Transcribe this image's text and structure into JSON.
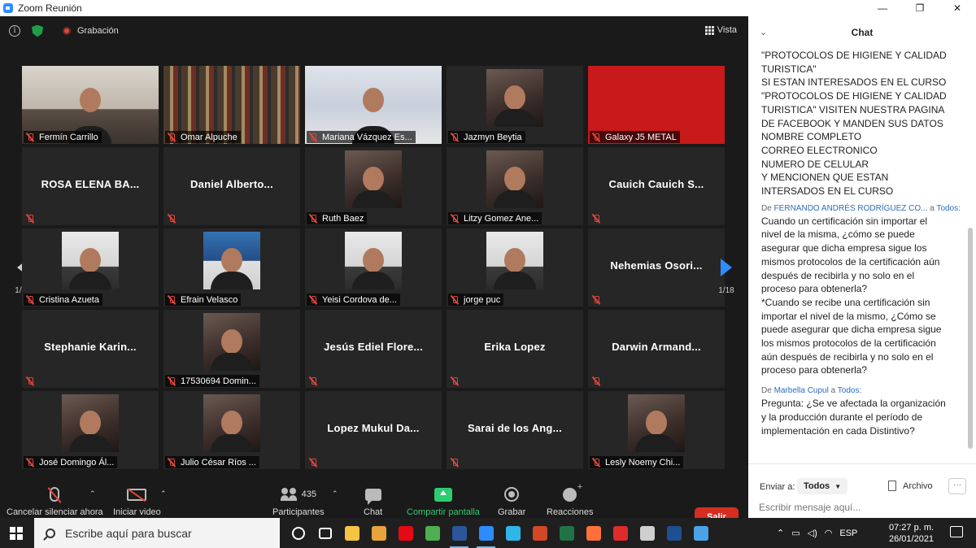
{
  "window": {
    "title": "Zoom Reunión",
    "controls": [
      "—",
      "❐",
      "✕"
    ]
  },
  "topbar": {
    "recording_label": "Grabación",
    "view_label": "Vista"
  },
  "gallery": {
    "page_indicator": "1/18",
    "tiles": [
      {
        "name": "Fermín Carrillo",
        "video": "office"
      },
      {
        "name": "Omar Alpuche",
        "video": "books"
      },
      {
        "name": "Mariana Vázquez Es...",
        "video": "slide",
        "active": true
      },
      {
        "name": "Jazmyn Beytia",
        "video": "photo"
      },
      {
        "name": "Galaxy J5 METAL",
        "video": "red"
      },
      {
        "name": "",
        "big_name": "ROSA ELENA BA..."
      },
      {
        "name": "",
        "big_name": "Daniel Alberto..."
      },
      {
        "name": "Ruth Baez",
        "video": "photo"
      },
      {
        "name": "Litzy Gomez Ane...",
        "video": "photo"
      },
      {
        "name": "",
        "big_name": "Cauich Cauich S..."
      },
      {
        "name": "Cristina Azueta",
        "video": "white"
      },
      {
        "name": "Efrain Velasco",
        "video": "blue"
      },
      {
        "name": "Yeisi Cordova de...",
        "video": "white"
      },
      {
        "name": "jorge puc",
        "video": "white"
      },
      {
        "name": "",
        "big_name": "Nehemias Osori..."
      },
      {
        "name": "",
        "big_name": "Stephanie Karin..."
      },
      {
        "name": "17530694 Domin...",
        "video": "photo"
      },
      {
        "name": "",
        "big_name": "Jesús Ediel Flore..."
      },
      {
        "name": "",
        "big_name": "Erika Lopez"
      },
      {
        "name": "",
        "big_name": "Darwin Armand..."
      },
      {
        "name": "José Domingo Ál...",
        "video": "photo"
      },
      {
        "name": "Julio César Ríos ...",
        "video": "photo"
      },
      {
        "name": "",
        "big_name": "Lopez Mukul Da..."
      },
      {
        "name": "",
        "big_name": "Sarai de los Ang..."
      },
      {
        "name": "Lesly Noemy Chi...",
        "video": "photo"
      }
    ]
  },
  "toolbar": {
    "mute_label": "Cancelar silenciar ahora",
    "video_label": "Iniciar video",
    "participants_label": "Participantes",
    "participants_count": "435",
    "chat_label": "Chat",
    "share_label": "Compartir pantalla",
    "record_label": "Grabar",
    "reactions_label": "Reacciones",
    "leave_label": "Salir"
  },
  "chat": {
    "title": "Chat",
    "first_message_lines": [
      "\"PROTOCOLOS DE HIGIENE Y CALIDAD",
      "TURISTICA\"",
      "SI ESTAN INTERESADOS EN EL CURSO",
      "\"PROTOCOLOS DE HIGIENE Y CALIDAD",
      "TURISTICA\" VISITEN NUESTRA PAGINA",
      "DE FACEBOOK Y MANDEN SUS DATOS",
      "NOMBRE COMPLETO",
      "CORREO ELECTRONICO",
      "NUMERO DE CELULAR",
      "Y MENCIONEN QUE ESTAN",
      "INTERSADOS EN EL CURSO"
    ],
    "message2": {
      "prefix": "De",
      "from": "FERNANDO ANDRÉS RODRÍGUEZ CO...",
      "to_word": "a",
      "to": "Todos:",
      "lines": [
        "Cuando un certificación sin importar el",
        "nivel de la misma, ¿cómo se puede",
        "asegurar que dicha empresa sigue los",
        "mismos protocolos de la certificación aún",
        "después de recibirla y no solo en el",
        "proceso para obtenerla?",
        "*Cuando se recibe una certificación sin",
        "importar el nivel de la mismo, ¿Cómo se",
        "puede asegurar que dicha empresa sigue",
        "los mismos protocolos de la certificación",
        "aún después de recibirla y no solo en el",
        "proceso para obtenerla?"
      ]
    },
    "message3": {
      "prefix": "De",
      "from": "Marbella Cupul",
      "to_word": "a",
      "to": "Todos:",
      "lines": [
        "Pregunta: ¿Se ve afectada la organización",
        "y la producción durante el período de",
        "implementación en cada Distintivo?"
      ]
    },
    "send_to_label": "Enviar a:",
    "recipient": "Todos",
    "file_label": "Archivo",
    "more_label": "···",
    "input_placeholder": "Escribir mensaje aquí..."
  },
  "taskbar": {
    "search_placeholder": "Escribe aquí para buscar",
    "apps": [
      {
        "name": "cortana-icon",
        "color": "#ffffff"
      },
      {
        "name": "task-view-icon",
        "color": "#ffffff"
      },
      {
        "name": "file-explorer-icon",
        "color": "#f4c542"
      },
      {
        "name": "media-icon",
        "color": "#e8a33d"
      },
      {
        "name": "netflix-icon",
        "color": "#e50914"
      },
      {
        "name": "chrome-icon",
        "color": "#4caf50"
      },
      {
        "name": "word-icon",
        "color": "#2b579a"
      },
      {
        "name": "zoom-icon",
        "color": "#2d8cff"
      },
      {
        "name": "edge-icon",
        "color": "#2fb6e8"
      },
      {
        "name": "powerpoint-icon",
        "color": "#d24726"
      },
      {
        "name": "excel-icon",
        "color": "#217346"
      },
      {
        "name": "firefox-icon",
        "color": "#ff7139"
      },
      {
        "name": "acrobat-icon",
        "color": "#e02b2b"
      },
      {
        "name": "store-icon",
        "color": "#cfcfcf"
      },
      {
        "name": "bold-app-icon",
        "color": "#1d4f91"
      },
      {
        "name": "mail-icon",
        "color": "#4aa3e8"
      }
    ],
    "language": "ESP",
    "time": "07:27 p. m.",
    "date": "26/01/2021"
  }
}
